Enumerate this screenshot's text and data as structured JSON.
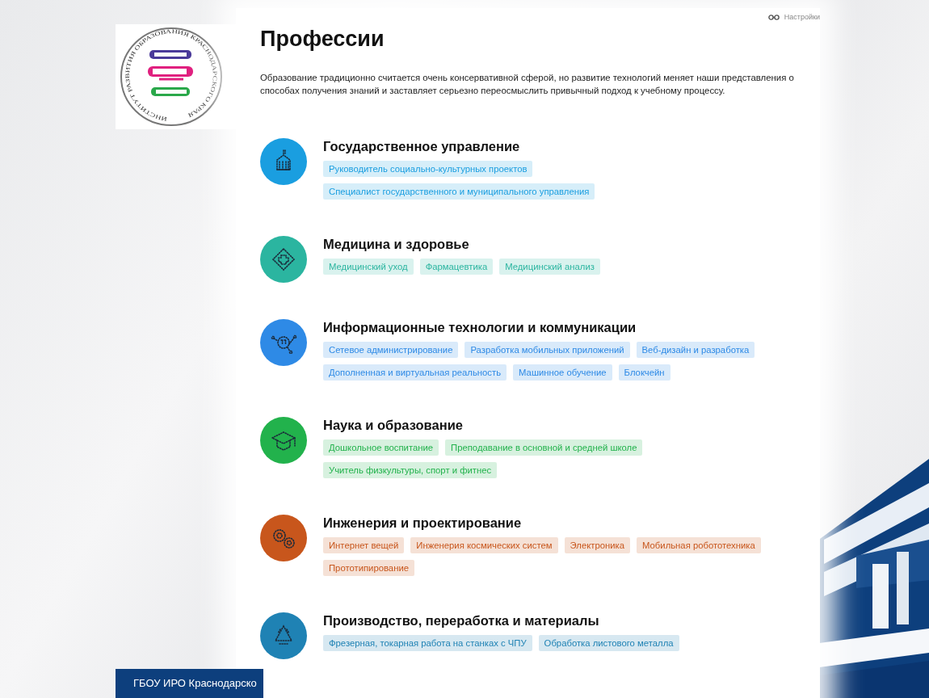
{
  "logo": {
    "ring_text": "ИНСТИТУТ РАЗВИТИЯ ОБРАЗОВАНИЯ КРАСНОДАРСКОГО КРАЯ"
  },
  "settings": {
    "label": "Настройки"
  },
  "page": {
    "title": "Профессии",
    "intro": "Образование традиционно считается очень консервативной сферой, но развитие технологий меняет наши представления о способах получения знаний и заставляет серьезно переосмыслить привычный подход к учебному процессу."
  },
  "categories": [
    {
      "title": "Государственное управление",
      "kind": "building",
      "color": "#1a9ee0",
      "tags": [
        "Руководитель социально-культурных проектов",
        "Специалист государственного и муниципального управления"
      ]
    },
    {
      "title": "Медицина и здоровье",
      "kind": "medical",
      "color": "#2bb5a0",
      "tags": [
        "Медицинский уход",
        "Фармацевтика",
        "Медицинский анализ"
      ]
    },
    {
      "title": "Информационные технологии и коммуникации",
      "kind": "it",
      "color": "#2e8ae6",
      "tags": [
        "Сетевое администрирование",
        "Разработка мобильных приложений",
        "Веб-дизайн и разработка",
        "Дополненная и виртуальная реальность",
        "Машинное обучение",
        "Блокчейн"
      ]
    },
    {
      "title": "Наука и образование",
      "kind": "cap",
      "color": "#22b24c",
      "tags": [
        "Дошкольное воспитание",
        "Преподавание в основной и средней школе",
        "Учитель физкультуры, спорт и фитнес"
      ]
    },
    {
      "title": "Инженерия и проектирование",
      "kind": "gears",
      "color": "#c8561c",
      "tags": [
        "Интернет вещей",
        "Инженерия космических систем",
        "Электроника",
        "Мобильная робототехника",
        "Прототипирование"
      ]
    },
    {
      "title": "Производство, переработка и материалы",
      "kind": "recycle",
      "color": "#1f82b4",
      "tags": [
        "Фрезерная, токарная работа на станках с ЧПУ",
        "Обработка листового металла"
      ]
    }
  ],
  "footer": {
    "text": "ГБОУ ИРО Краснодарско"
  }
}
